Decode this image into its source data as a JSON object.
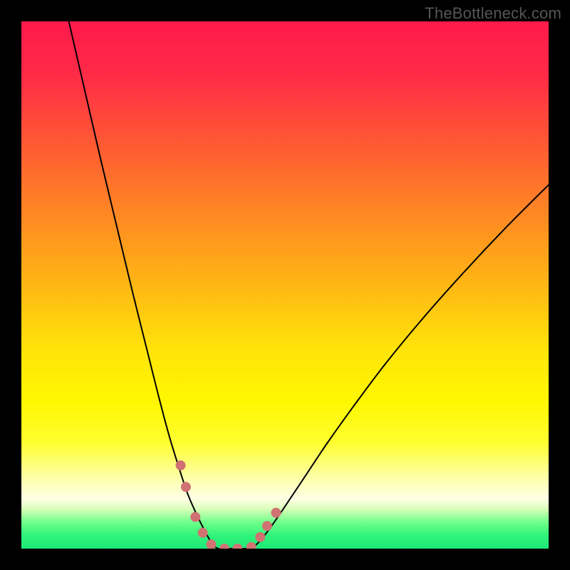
{
  "watermark": "TheBottleneck.com",
  "gradient": {
    "stops": [
      {
        "offset": 0.0,
        "color": "#ff1a4b"
      },
      {
        "offset": 0.1,
        "color": "#ff2a47"
      },
      {
        "offset": 0.22,
        "color": "#ff5535"
      },
      {
        "offset": 0.35,
        "color": "#ff8225"
      },
      {
        "offset": 0.5,
        "color": "#ffb714"
      },
      {
        "offset": 0.63,
        "color": "#ffe609"
      },
      {
        "offset": 0.72,
        "color": "#fff700"
      },
      {
        "offset": 0.8,
        "color": "#ffff30"
      },
      {
        "offset": 0.86,
        "color": "#fdffa0"
      },
      {
        "offset": 0.905,
        "color": "#ffffe6"
      },
      {
        "offset": 0.925,
        "color": "#d8ffb8"
      },
      {
        "offset": 0.95,
        "color": "#6fff8a"
      },
      {
        "offset": 0.975,
        "color": "#30f47a"
      },
      {
        "offset": 1.0,
        "color": "#1de877"
      }
    ]
  },
  "chart_data": {
    "type": "line",
    "title": "",
    "xlabel": "",
    "ylabel": "",
    "xlim": [
      0,
      100
    ],
    "ylim": [
      0,
      100
    ],
    "series": [
      {
        "name": "left-curve",
        "stroke": "#000000",
        "x": [
          9,
          12,
          15,
          18,
          21,
          24,
          26,
          28,
          30,
          31.5,
          33,
          34.3,
          35.3,
          36,
          36.6,
          37,
          37.3
        ],
        "y": [
          100,
          87,
          74,
          61.5,
          49,
          37,
          29,
          21.5,
          15,
          10.5,
          7,
          4.3,
          2.4,
          1.2,
          0.5,
          0.15,
          0
        ]
      },
      {
        "name": "valley-floor",
        "stroke": "#000000",
        "x": [
          37.3,
          40,
          43.3
        ],
        "y": [
          0,
          0,
          0
        ]
      },
      {
        "name": "right-curve",
        "stroke": "#000000",
        "x": [
          43.3,
          44,
          45,
          46.5,
          48.5,
          51,
          54,
          58,
          63,
          69,
          76,
          84,
          92,
          100
        ],
        "y": [
          0,
          0.3,
          1.2,
          3,
          5.8,
          9.5,
          14,
          20,
          27,
          35,
          43.5,
          52.5,
          61,
          69
        ]
      }
    ],
    "markers": {
      "name": "threshold-dots",
      "color": "#d07272",
      "radius_px": 7,
      "points": [
        {
          "x": 30.2,
          "y": 15.8
        },
        {
          "x": 31.2,
          "y": 11.7
        },
        {
          "x": 33.0,
          "y": 6.0
        },
        {
          "x": 34.4,
          "y": 3.0
        },
        {
          "x": 36.0,
          "y": 0.8
        },
        {
          "x": 38.5,
          "y": 0.0
        },
        {
          "x": 41.0,
          "y": 0.0
        },
        {
          "x": 43.6,
          "y": 0.3
        },
        {
          "x": 45.3,
          "y": 2.2
        },
        {
          "x": 46.6,
          "y": 4.3
        },
        {
          "x": 48.3,
          "y": 6.8
        }
      ]
    }
  }
}
